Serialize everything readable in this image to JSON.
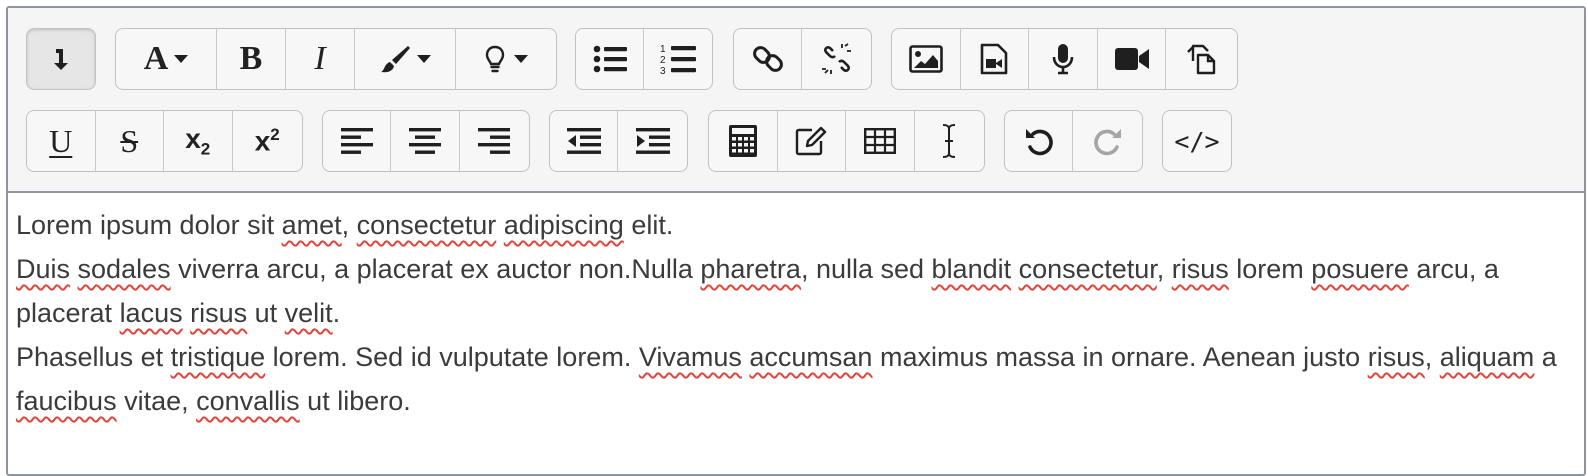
{
  "toolbar": {
    "row1": [
      {
        "name": "toolbar-toggle-icon",
        "icon": "arrow-down-corner"
      },
      {
        "name": "font-size-icon",
        "icon": "font-A-dropdown",
        "label": "A"
      },
      {
        "name": "bold-icon",
        "icon": "bold",
        "label": "B"
      },
      {
        "name": "italic-icon",
        "icon": "italic",
        "label": "I"
      },
      {
        "name": "font-color-icon",
        "icon": "paint-brush-dropdown"
      },
      {
        "name": "styles-icon",
        "icon": "lightbulb-dropdown"
      },
      {
        "name": "unordered-list-icon",
        "icon": "bullet-list"
      },
      {
        "name": "ordered-list-icon",
        "icon": "numbered-list"
      },
      {
        "name": "link-icon",
        "icon": "link"
      },
      {
        "name": "unlink-icon",
        "icon": "unlink"
      },
      {
        "name": "image-icon",
        "icon": "image"
      },
      {
        "name": "media-icon",
        "icon": "file-video"
      },
      {
        "name": "record-audio-icon",
        "icon": "microphone"
      },
      {
        "name": "record-video-icon",
        "icon": "video-camera"
      },
      {
        "name": "manage-files-icon",
        "icon": "files"
      }
    ],
    "row2": [
      {
        "name": "underline-icon",
        "icon": "underline",
        "label": "U"
      },
      {
        "name": "strikethrough-icon",
        "icon": "strikethrough",
        "label": "S"
      },
      {
        "name": "subscript-icon",
        "icon": "subscript",
        "label": "x",
        "sub": "2"
      },
      {
        "name": "superscript-icon",
        "icon": "superscript",
        "label": "x",
        "sup": "2"
      },
      {
        "name": "align-left-icon",
        "icon": "align-left"
      },
      {
        "name": "align-center-icon",
        "icon": "align-center"
      },
      {
        "name": "align-right-icon",
        "icon": "align-right"
      },
      {
        "name": "outdent-icon",
        "icon": "outdent"
      },
      {
        "name": "indent-icon",
        "icon": "indent"
      },
      {
        "name": "equation-icon",
        "icon": "calculator"
      },
      {
        "name": "character-map-icon",
        "icon": "pencil-square"
      },
      {
        "name": "table-icon",
        "icon": "table"
      },
      {
        "name": "accessibility-checker-icon",
        "icon": "text-cursor"
      },
      {
        "name": "undo-icon",
        "icon": "undo"
      },
      {
        "name": "redo-icon",
        "icon": "redo"
      },
      {
        "name": "html-icon",
        "icon": "code",
        "label": "</>"
      }
    ]
  },
  "content": {
    "p1": [
      {
        "t": "Lorem ipsum dolor sit "
      },
      {
        "t": "amet",
        "sp": true
      },
      {
        "t": ", "
      },
      {
        "t": "consectetur",
        "sp": true
      },
      {
        "t": " "
      },
      {
        "t": "adipiscing",
        "sp": true
      },
      {
        "t": " elit."
      }
    ],
    "p2": [
      {
        "t": "Duis",
        "sp": true
      },
      {
        "t": " "
      },
      {
        "t": "sodales",
        "sp": true
      },
      {
        "t": " viverra arcu, a placerat ex auctor non.Nulla "
      },
      {
        "t": "pharetra",
        "sp": true
      },
      {
        "t": ", nulla sed "
      },
      {
        "t": "blandit",
        "sp": true
      },
      {
        "t": " "
      },
      {
        "t": "consectetur",
        "sp": true
      },
      {
        "t": ", "
      },
      {
        "t": "risus",
        "sp": true
      },
      {
        "t": " lorem "
      },
      {
        "t": "posuere",
        "sp": true
      },
      {
        "t": " arcu, a placerat "
      },
      {
        "t": "lacus",
        "sp": true
      },
      {
        "t": " "
      },
      {
        "t": "risus",
        "sp": true
      },
      {
        "t": " ut "
      },
      {
        "t": "velit",
        "sp": true
      },
      {
        "t": "."
      }
    ],
    "p3": [
      {
        "t": "Phasellus et "
      },
      {
        "t": "tristique",
        "sp": true
      },
      {
        "t": " lorem. Sed id vulputate lorem. "
      },
      {
        "t": "Vivamus",
        "sp": true
      },
      {
        "t": " "
      },
      {
        "t": "accumsan",
        "sp": true
      },
      {
        "t": " maximus massa in ornare. Aenean justo "
      },
      {
        "t": "risus",
        "sp": true
      },
      {
        "t": ", "
      },
      {
        "t": "aliquam",
        "sp": true
      },
      {
        "t": " a "
      },
      {
        "t": "faucibus",
        "sp": true
      },
      {
        "t": " vitae, "
      },
      {
        "t": "convallis",
        "sp": true
      },
      {
        "t": " ut libero."
      }
    ]
  },
  "colors": {
    "icon": "#1f1f1f",
    "disabled_icon": "#9a9a9a",
    "spellcheck": "#e0463c",
    "text": "#3b3b3b"
  }
}
